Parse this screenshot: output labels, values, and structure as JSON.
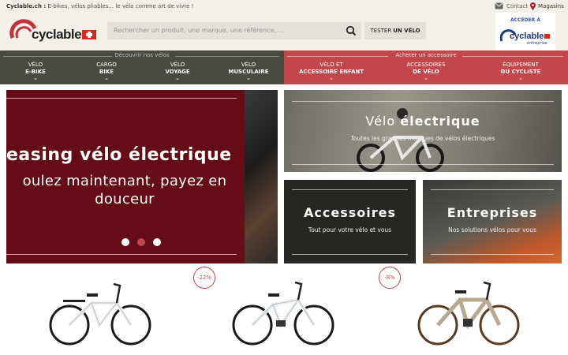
{
  "topbar": {
    "brand": "Cyclable.ch :",
    "tagline": " E-bikes, vélos pliables... le vélo comme art de vivre !",
    "contact": "Contact",
    "stores": "Magasins"
  },
  "header": {
    "logo_text": "cyclable",
    "search_placeholder": "Rechercher un produit, une marque, une référence, ...",
    "test_btn_prefix": "TESTER",
    "test_btn_bold": "UN VÉLO",
    "pro_label": "ACCÉDER À",
    "pro_logo_text": "cyclable",
    "pro_logo_sub": "entreprise"
  },
  "nav": {
    "left_header": "Découvrir nos vélos",
    "right_header": "Acheter un accessoire",
    "left_items": [
      {
        "top": "VÉLO",
        "sub": "E-BIKE"
      },
      {
        "top": "CARGO",
        "sub": "BIKE"
      },
      {
        "top": "VÉLO",
        "sub": "VOYAGE"
      },
      {
        "top": "VÉLO",
        "sub": "MUSCULAIRE"
      }
    ],
    "right_items": [
      {
        "top": "VÉLO ET",
        "sub": "ACCESSOIRE ENFANT"
      },
      {
        "top": "ACCESSOIRES",
        "sub": "DE VÉLO"
      },
      {
        "top": "ÉQUIPEMENT",
        "sub": "DU CYCLISTE"
      }
    ]
  },
  "hero": {
    "title": "easing vélo électrique",
    "subtitle_line1": "oulez maintenant, payez en",
    "subtitle_line2": "douceur",
    "active_slide": 2,
    "slide_count": 3
  },
  "tiles": {
    "velo_title_a": "Vélo ",
    "velo_title_b": "électrique",
    "velo_sub": "Toutes les grandes marques de vélos électriques",
    "acc_title": "Accessoires",
    "acc_sub": "Tout pour votre vélo et vous",
    "ent_title": "Entreprises",
    "ent_sub": "Nos solutions vélos pour vous"
  },
  "products": {
    "badge1": "-22%",
    "badge2": "-8%"
  },
  "colors": {
    "brand_red": "#c2474a",
    "hero_bg": "#650c17",
    "nav_dark": "#4a4a42"
  }
}
